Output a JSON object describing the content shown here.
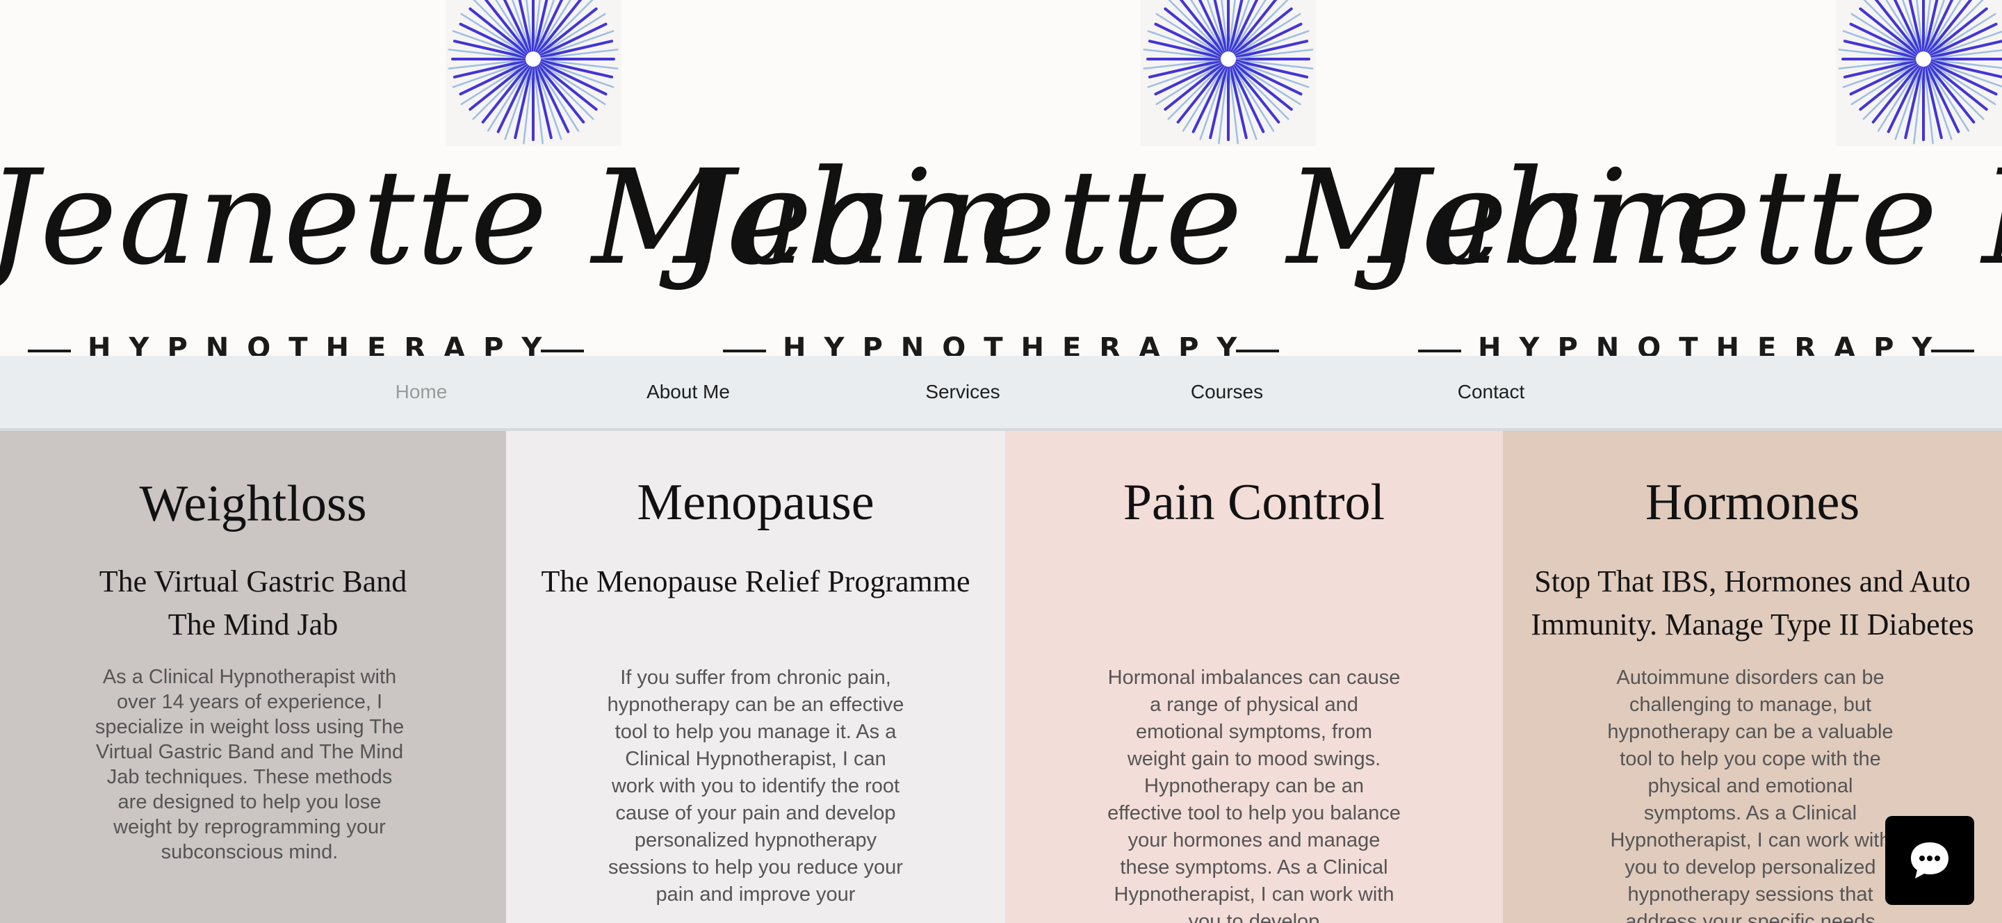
{
  "brand": {
    "name": "Jeanette Mabin",
    "tagline": "HYPNOTHERAPY"
  },
  "nav": {
    "items": [
      {
        "label": "Home",
        "active": true
      },
      {
        "label": "About Me",
        "active": false
      },
      {
        "label": "Services",
        "active": false
      },
      {
        "label": "Courses",
        "active": false
      },
      {
        "label": "Contact",
        "active": false
      }
    ]
  },
  "panels": [
    {
      "title": "Weightloss",
      "subtitle_lines": [
        "The Virtual Gastric Band",
        "The Mind Jab"
      ],
      "body": "As a Clinical Hypnotherapist with over 14 years of experience, I specialize in weight loss using The Virtual Gastric Band and The Mind Jab techniques. These methods are designed to help you lose weight by reprogramming your subconscious mind.",
      "color": "#cbc5c3"
    },
    {
      "title": "Menopause",
      "subtitle_lines": [
        "The Menopause Relief Programme"
      ],
      "body": "If you suffer from chronic pain, hypnotherapy can be an effective tool to help you manage it. As a Clinical Hypnotherapist, I can work with you to identify the root cause of your pain and develop personalized hypnotherapy sessions to help you reduce your pain and improve your",
      "color": "#efedee"
    },
    {
      "title": "Pain Control",
      "subtitle_lines": [],
      "body": "Hormonal imbalances can cause a range of physical and emotional symptoms, from weight gain to mood swings. Hypnotherapy can be an effective tool to help you balance your hormones and manage these symptoms. As a Clinical Hypnotherapist, I can work with you to develop",
      "color": "#f3ddd8"
    },
    {
      "title": "Hormones",
      "subtitle_lines": [
        "Stop That IBS, Hormones and Auto",
        "Immunity. Manage Type II Diabetes"
      ],
      "body": "Autoimmune disorders can be challenging to manage, but hypnotherapy can be a valuable tool to help you cope with the physical and emotional symptoms. As a Clinical Hypnotherapist, I can work with you to develop personalized hypnotherapy sessions that address your specific needs",
      "color": "#e0cbbd"
    }
  ],
  "colors": {
    "sunburst": "#3a2ad6",
    "sunburst_light": "#8fb6e0",
    "nav_bg": "#e9edf0",
    "nav_active": "#9a9a9a"
  },
  "icons": {
    "chat": "chat-bubble-icon",
    "logo": "sunburst-logo-icon"
  }
}
